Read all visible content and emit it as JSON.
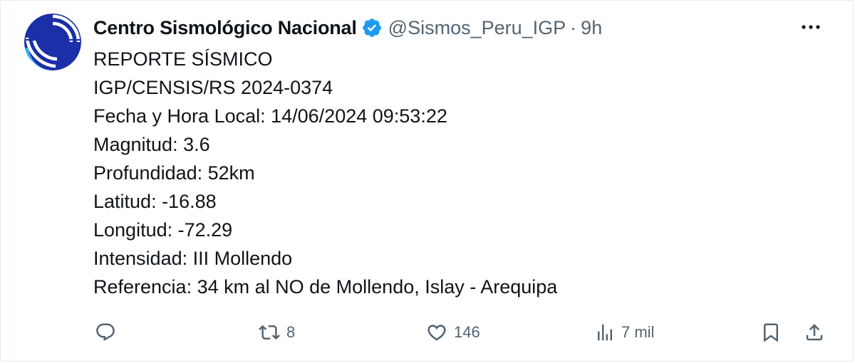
{
  "tweet": {
    "author": {
      "display_name": "Centro Sismológico Nacional",
      "handle": "@Sismos_Peru_IGP",
      "separator": "·",
      "time": "9h",
      "verified": true,
      "verified_color": "#1d9bf0"
    },
    "lines": [
      "REPORTE SÍSMICO",
      "IGP/CENSIS/RS 2024-0374",
      "Fecha y Hora Local: 14/06/2024 09:53:22",
      "Magnitud: 3.6",
      "Profundidad: 52km",
      "Latitud: -16.88",
      "Longitud: -72.29",
      "Intensidad: III Mollendo",
      "Referencia: 34 km al NO de Mollendo, Islay - Arequipa"
    ],
    "actions": {
      "reply": {
        "icon": "reply-icon",
        "count": ""
      },
      "retweet": {
        "icon": "retweet-icon",
        "count": "8"
      },
      "like": {
        "icon": "heart-icon",
        "count": "146"
      },
      "views": {
        "icon": "views-icon",
        "count": "7 mil"
      },
      "bookmark": {
        "icon": "bookmark-icon"
      },
      "share": {
        "icon": "share-icon"
      }
    },
    "more_icon": "more-horizontal-icon"
  },
  "colors": {
    "text_primary": "#0f1419",
    "text_secondary": "#536471",
    "avatar_bg": "#1a2fa8",
    "avatar_accent": "#3ea8f5"
  }
}
